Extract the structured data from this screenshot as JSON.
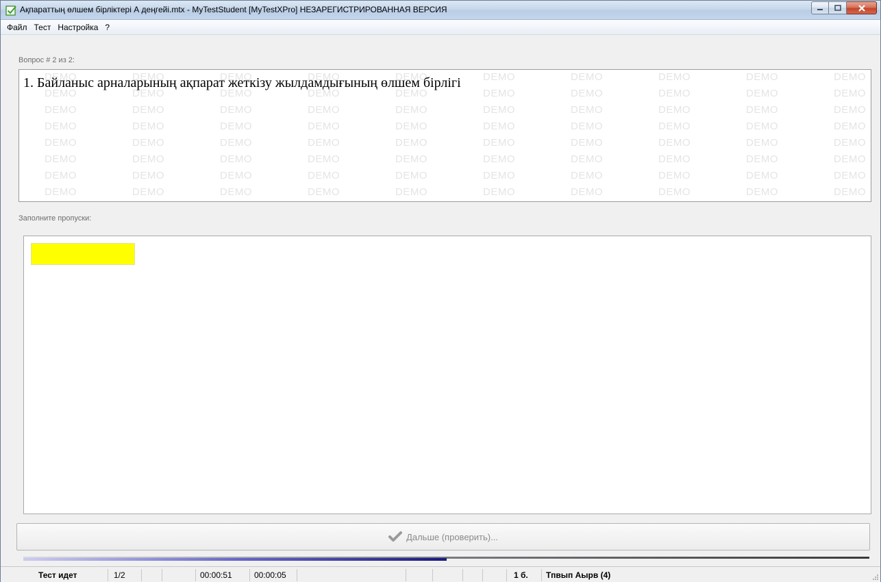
{
  "window": {
    "title": "Ақпараттың өлшем бірліктері  А деңгейі.mtx - MyTestStudent [MyTestXPro] НЕЗАРЕГИСТРИРОВАННАЯ ВЕРСИЯ",
    "icon": "check-square-icon"
  },
  "menu": {
    "items": [
      "Файл",
      "Тест",
      "Настройка",
      "?"
    ]
  },
  "question": {
    "counter": "Вопрос # 2 из 2:",
    "text": "1. Байланыс  арналарының  ақпарат жеткізу жылдамдығының өлшем бірлігі",
    "watermark": "DEMO"
  },
  "answer": {
    "instruction": "Заполните пропуски:",
    "blank_value": "",
    "blank_color": "#ffff00"
  },
  "next_button": {
    "label": "Дальше (проверить)...",
    "icon": "check-icon"
  },
  "progress": {
    "fraction": 0.5
  },
  "status": {
    "state": "Тест идет",
    "question_index": "1/2",
    "elapsed_total": "00:00:51",
    "elapsed_question": "00:00:05",
    "score": "1 б.",
    "student": "Тпвып Аырв (4)"
  }
}
